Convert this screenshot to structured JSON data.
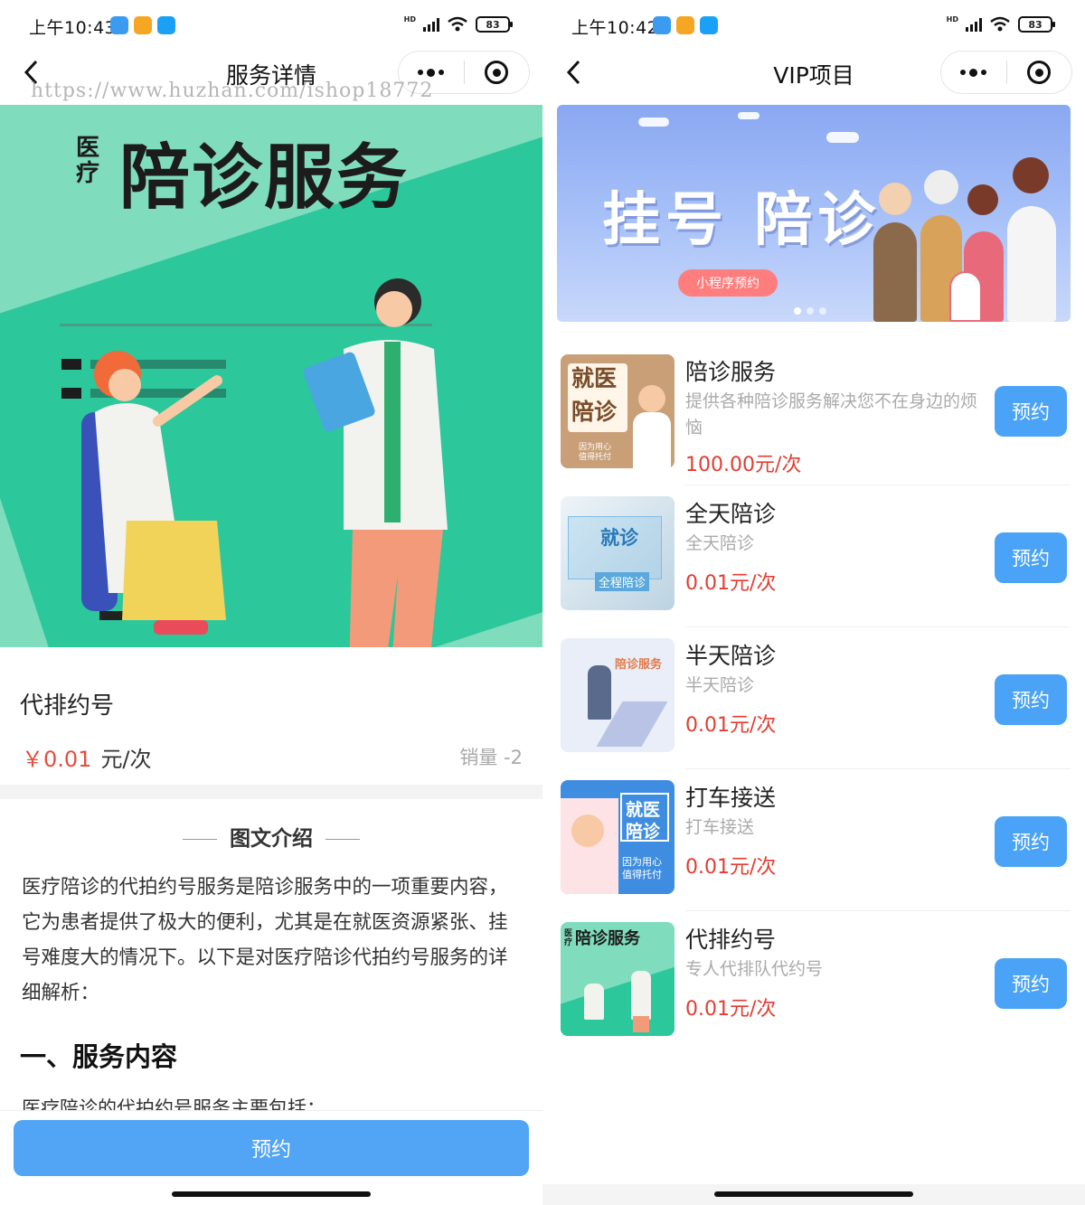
{
  "status": {
    "left_time": "上午10:43",
    "right_time": "上午10:42",
    "network": "HD",
    "battery": "83"
  },
  "left": {
    "nav_title": "服务详情",
    "watermark": "https://www.huzhan.com/ishop18772",
    "hero": {
      "tag": "医疗",
      "heading": "陪诊服务"
    },
    "product_name": "代排约号",
    "price": "￥0.01",
    "unit": "元/次",
    "sales": "销量 -2",
    "section_title": "图文介绍",
    "article": "医疗陪诊的代拍约号服务是陪诊服务中的一项重要内容，它为患者提供了极大的便利，尤其是在就医资源紧张、挂号难度大的情况下。以下是对医疗陪诊代拍约号服务的详细解析：",
    "article_heading": "一、服务内容",
    "article_cut": "医疗陪诊的代拍约号服务主要包括：",
    "book_label": "预约"
  },
  "right": {
    "nav_title": "VIP项目",
    "banner": {
      "title": "挂号 陪诊",
      "pill": "小程序预约"
    },
    "items": [
      {
        "title": "陪诊服务",
        "desc": "提供各种陪诊服务解决您不在身边的烦恼",
        "price": "100.00元/次",
        "button": "预约",
        "thumb_line1": "就医",
        "thumb_line2": "陪诊",
        "thumb_small": "因为用心 值得托付"
      },
      {
        "title": "全天陪诊",
        "desc": "全天陪诊",
        "price": "0.01元/次",
        "button": "预约",
        "thumb_line1": "就诊",
        "thumb_line2": "全程陪诊"
      },
      {
        "title": "半天陪诊",
        "desc": "半天陪诊",
        "price": "0.01元/次",
        "button": "预约",
        "thumb_line1": "陪诊服务"
      },
      {
        "title": "打车接送",
        "desc": "打车接送",
        "price": "0.01元/次",
        "button": "预约",
        "thumb_line1": "就医",
        "thumb_line2": "陪诊",
        "thumb_small": "因为用心 值得托付"
      },
      {
        "title": "代排约号",
        "desc": "专人代排队代约号",
        "price": "0.01元/次",
        "button": "预约",
        "thumb_line1": "陪诊服务",
        "thumb_tag": "医疗"
      }
    ]
  },
  "colors": {
    "accent_blue": "#4aa3f7",
    "price_red": "#e43c32",
    "hero_green": "#7fdcbc"
  }
}
